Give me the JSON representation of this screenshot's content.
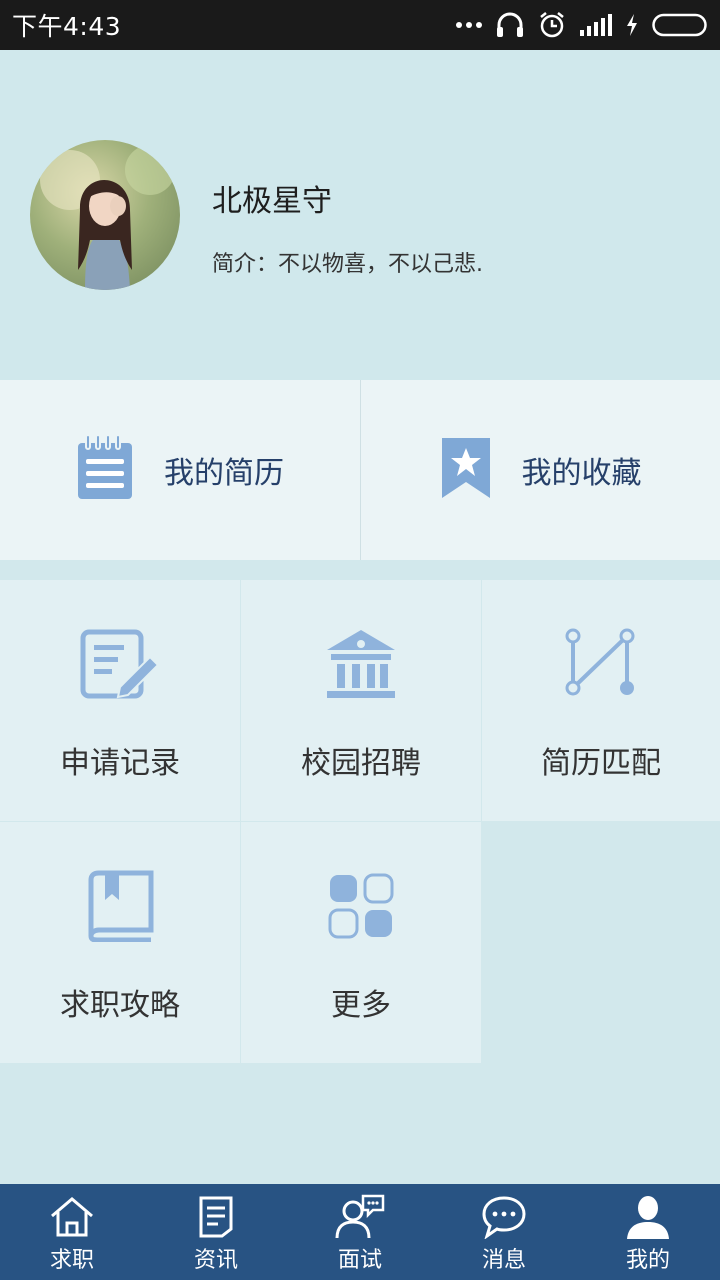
{
  "status_bar": {
    "time": "下午4:43",
    "icons": [
      "more-dots-icon",
      "headset-icon",
      "alarm-icon",
      "signal-icon",
      "charging-icon",
      "battery-icon"
    ]
  },
  "profile": {
    "name": "北极星守",
    "bio": "简介：不以物喜，不以己悲."
  },
  "top_tiles": [
    {
      "label": "我的简历",
      "icon": "notepad-icon"
    },
    {
      "label": "我的收藏",
      "icon": "bookmark-star-icon"
    }
  ],
  "grid": [
    {
      "label": "申请记录",
      "icon": "edit-document-icon"
    },
    {
      "label": "校园招聘",
      "icon": "institution-icon"
    },
    {
      "label": "简历匹配",
      "icon": "match-path-icon"
    },
    {
      "label": "求职攻略",
      "icon": "book-icon"
    },
    {
      "label": "更多",
      "icon": "more-apps-icon"
    }
  ],
  "bottom_nav": [
    {
      "label": "求职",
      "icon": "home-icon"
    },
    {
      "label": "资讯",
      "icon": "news-icon"
    },
    {
      "label": "面试",
      "icon": "interview-icon"
    },
    {
      "label": "消息",
      "icon": "chat-bubble-icon"
    },
    {
      "label": "我的",
      "icon": "user-icon"
    }
  ],
  "colors": {
    "background": "#d2e8ec",
    "accent_icon": "#7fa8d6",
    "nav_bar": "#285383",
    "status_bar": "#1a1a1a",
    "tile_light": "#ebf4f6",
    "tile_grid": "#e2f0f3"
  }
}
